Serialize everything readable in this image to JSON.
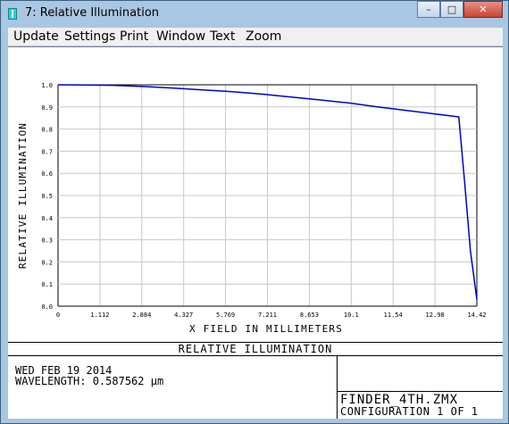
{
  "window": {
    "title": "7: Relative Illumination"
  },
  "caption_buttons": {
    "minimize": "–",
    "maximize": "□",
    "close": "✕"
  },
  "menu": [
    {
      "label": "Update"
    },
    {
      "label": "Settings"
    },
    {
      "label": "Print"
    },
    {
      "label": "Window"
    },
    {
      "label": "Text"
    },
    {
      "label": "Zoom"
    }
  ],
  "chart_data": {
    "type": "line",
    "title": "RELATIVE ILLUMINATION",
    "xlabel": "X FIELD IN MILLIMETERS",
    "ylabel": "RELATIVE ILLUMINATION",
    "xlim": [
      0,
      14.42
    ],
    "ylim": [
      0,
      1.0
    ],
    "x_ticks": [
      "0",
      "1.112",
      "2.884",
      "4.327",
      "5.769",
      "7.211",
      "8.653",
      "10.1",
      "11.54",
      "12.98",
      "14.42"
    ],
    "y_ticks": [
      "0.0",
      "0.1",
      "0.2",
      "0.3",
      "0.4",
      "0.5",
      "0.6",
      "0.7",
      "0.8",
      "0.9",
      "1.0"
    ],
    "grid": true,
    "line_color": "#0000cc",
    "series": [
      {
        "x": [
          0,
          1.0,
          2.0,
          3.0,
          4.0,
          5.0,
          6.0,
          7.0,
          8.0,
          9.0,
          10.0,
          11.0,
          12.0,
          13.0,
          13.5,
          13.8,
          14.0,
          14.2,
          14.42
        ],
        "y": [
          1.0,
          0.999,
          0.997,
          0.992,
          0.985,
          0.977,
          0.969,
          0.958,
          0.945,
          0.932,
          0.918,
          0.9,
          0.884,
          0.868,
          0.86,
          0.855,
          0.56,
          0.25,
          0.03
        ]
      }
    ]
  },
  "footer": {
    "date": "WED FEB 19 2014",
    "wavelength": "WAVELENGTH: 0.587562 µm",
    "filename": "FINDER_4TH.ZMX",
    "configuration": "CONFIGURATION 1 OF 1"
  }
}
